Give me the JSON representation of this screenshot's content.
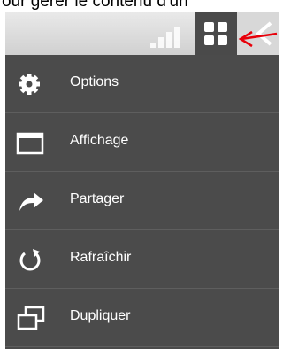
{
  "caption": "our gérer le contenu d'un",
  "colors": {
    "panel_bg": "#4a4a4a",
    "topbar_bg": "#dcdcdc",
    "text": "#ffffff",
    "annotation_arrow": "#e8000a"
  },
  "menu": {
    "items": [
      {
        "label": "Options",
        "icon": "gear-icon"
      },
      {
        "label": "Affichage",
        "icon": "window-icon"
      },
      {
        "label": "Partager",
        "icon": "share-arrow-icon"
      },
      {
        "label": "Rafraîchir",
        "icon": "refresh-icon"
      },
      {
        "label": "Dupliquer",
        "icon": "duplicate-icon"
      }
    ]
  }
}
